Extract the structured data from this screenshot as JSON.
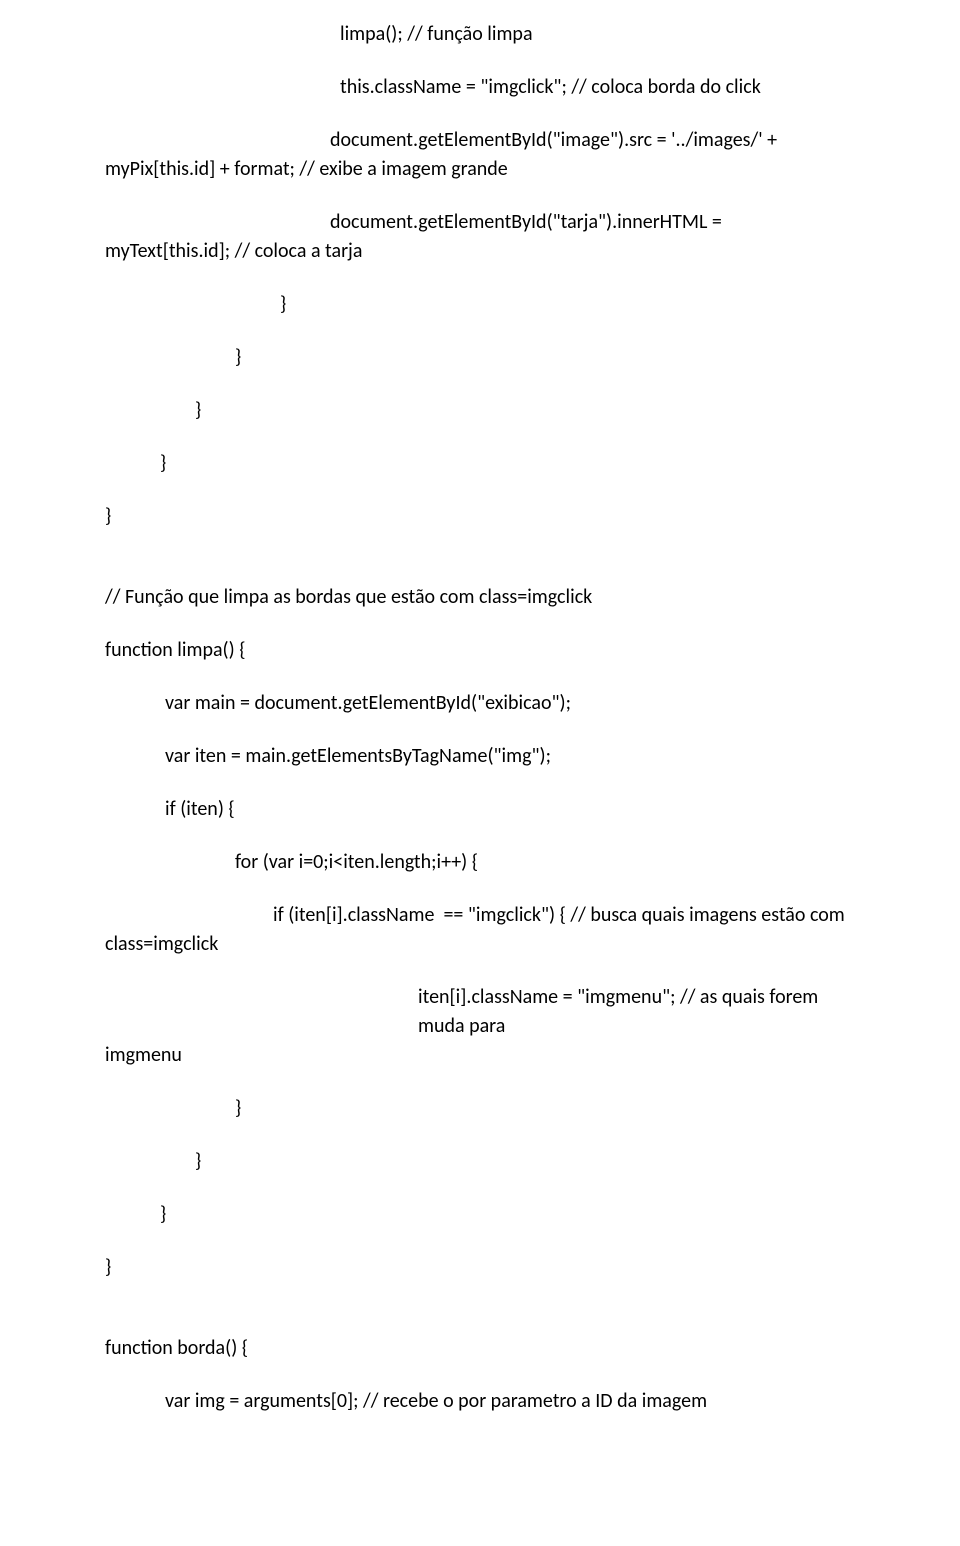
{
  "lines": {
    "l1": "limpa(); // função limpa",
    "l2": "this.className = \"imgclick\"; // coloca borda do click",
    "l3a": "document.getElementById(\"image\").src = '../images/' +",
    "l3b": "myPix[this.id] + format; // exibe a imagem grande",
    "l4a": "document.getElementById(\"tarja\").innerHTML =",
    "l4b": "myText[this.id]; // coloca a tarja",
    "c1": "}",
    "c2": "}",
    "c3": "}",
    "c4": "}",
    "c5": "}",
    "l5": "// Função que limpa as bordas que estão com class=imgclick",
    "l6": "function limpa() {",
    "l7": "var main = document.getElementById(\"exibicao\");",
    "l8": "var iten = main.getElementsByTagName(\"img\");",
    "l9": "if (iten) {",
    "l10": "for (var i=0;i<iten.length;i++) {",
    "l11a": "if (iten[i].className  == \"imgclick\") { // busca quais imagens estão com",
    "l11b": "class=imgclick",
    "l12a": "iten[i].className = \"imgmenu\"; // as quais forem muda para",
    "l12b": "imgmenu",
    "c6": "}",
    "c7": "}",
    "c8": "}",
    "c9": "}",
    "l13": "function borda() {",
    "l14": "var img = arguments[0]; // recebe o por parametro a ID da imagem"
  }
}
